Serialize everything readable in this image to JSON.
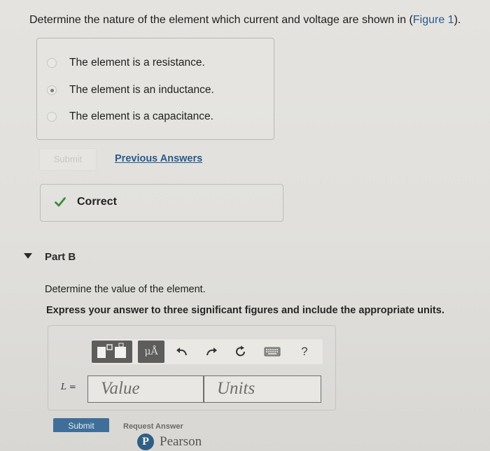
{
  "question": {
    "text_before": "Determine the nature of the element which current and voltage are shown in (",
    "figure_link": "Figure 1",
    "text_after": ")."
  },
  "choices": [
    {
      "label": "The element is a resistance.",
      "selected": false
    },
    {
      "label": "The element is an inductance.",
      "selected": true
    },
    {
      "label": "The element is a capacitance.",
      "selected": false
    }
  ],
  "part_a": {
    "submit_label": "Submit",
    "previous_answers_label": "Previous Answers",
    "feedback_label": "Correct"
  },
  "part_b": {
    "title": "Part B",
    "prompt": "Determine the value of the element.",
    "instruction": "Express your answer to three significant figures and include the appropriate units.",
    "toolbar": {
      "units_button": "μÅ",
      "help_button": "?"
    },
    "variable_label": "L =",
    "value_placeholder": "Value",
    "units_placeholder": "Units",
    "submit_label": "Submit",
    "request_answer_label": "Request Answer"
  },
  "footer": {
    "brand_letter": "P",
    "brand_name": "Pearson"
  },
  "colors": {
    "link": "#2a5a8c",
    "submit_bg": "#3f6f99",
    "check": "#3f8a3a"
  }
}
